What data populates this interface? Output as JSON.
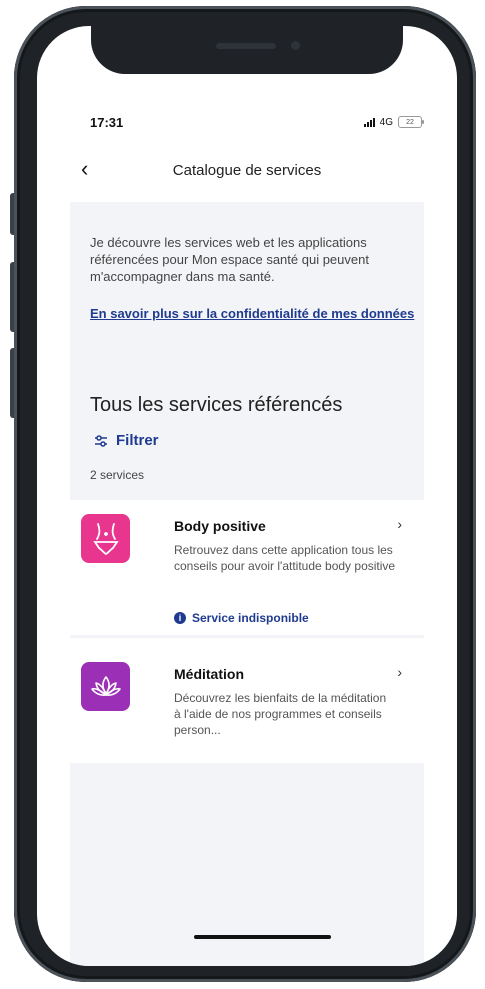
{
  "status_bar": {
    "time": "17:31",
    "network": "4G",
    "battery": "22"
  },
  "nav": {
    "back_icon": "chevron-left-icon",
    "title": "Catalogue de services"
  },
  "intro": {
    "text": "Je découvre les services web et les applications référencées pour Mon espace santé qui peuvent m'accompagner dans ma santé.",
    "link": "En savoir plus sur la confidentialité de mes données"
  },
  "section": {
    "title": "Tous les services référencés",
    "filter_label": "Filtrer",
    "count": "2 services"
  },
  "services": [
    {
      "title": "Body positive",
      "description": "Retrouvez dans cette application tous les conseils pour avoir l'attitude body positive",
      "notice": "Service indisponible",
      "icon": "body-icon",
      "color": "#e8368f"
    },
    {
      "title": "Méditation",
      "description": "Découvrez les bienfaits de la méditation à l'aide de nos programmes et conseils person...",
      "icon": "lotus-icon",
      "color": "#9b2fb6"
    }
  ],
  "colors": {
    "link": "#1f3b8f",
    "background": "#f3f4f8"
  }
}
